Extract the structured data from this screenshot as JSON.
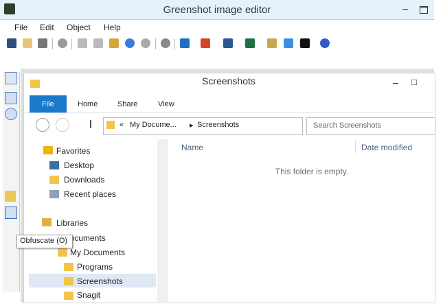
{
  "window": {
    "title": "Greenshot image editor",
    "minimize": "–",
    "maximize": "□"
  },
  "menu": [
    "File",
    "Edit",
    "Object",
    "Help"
  ],
  "tooltip": "Obfuscate (O)",
  "explorer": {
    "title": "Screenshots",
    "minimize": "–",
    "maximize": "□",
    "ribbon_tabs": [
      "File",
      "Home",
      "Share",
      "View"
    ],
    "address": {
      "overflow": "«",
      "crumb_parent": "My Docume...",
      "separator": "▸",
      "crumb_current": "Screenshots"
    },
    "search_placeholder": "Search Screenshots",
    "nav": {
      "favorites": "Favorites",
      "desktop": "Desktop",
      "downloads": "Downloads",
      "recent": "Recent places",
      "libraries": "Libraries",
      "documents": "Documents",
      "my_documents": "My Documents",
      "programs": "Programs",
      "screenshots": "Screenshots",
      "snagit": "Snagit"
    },
    "columns": {
      "name": "Name",
      "date_modified": "Date modified"
    },
    "empty_message": "This folder is empty."
  },
  "colors": {
    "accent": "#1979ca",
    "folder": "#f2c44a",
    "selection": "#dfe9f5"
  }
}
